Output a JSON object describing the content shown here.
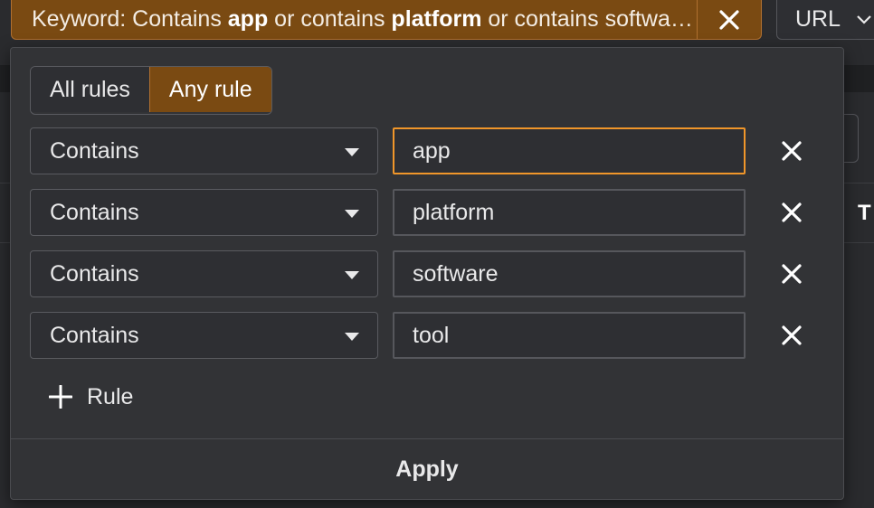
{
  "filter_chip": {
    "prefix": "Keyword: Contains ",
    "term1": "app",
    "join1": " or contains ",
    "term2": "platform",
    "tail": " or contains software or contains tool"
  },
  "url_chip": {
    "label": "URL"
  },
  "match_mode": {
    "options": [
      {
        "label": "All rules",
        "active": false
      },
      {
        "label": "Any rule",
        "active": true
      }
    ]
  },
  "rules": [
    {
      "operator": "Contains",
      "value": "app"
    },
    {
      "operator": "Contains",
      "value": "platform"
    },
    {
      "operator": "Contains",
      "value": "software"
    },
    {
      "operator": "Contains",
      "value": "tool"
    }
  ],
  "add_rule_label": "Rule",
  "apply_label": "Apply",
  "background": {
    "peek_text": "T"
  },
  "colors": {
    "accent": "#7a4a12",
    "focus": "#f0962a",
    "panel": "#323336"
  },
  "icons": {
    "close": "close-icon",
    "dropdown": "caret-down-icon",
    "add": "plus-icon",
    "chevron": "chevron-down-icon"
  }
}
